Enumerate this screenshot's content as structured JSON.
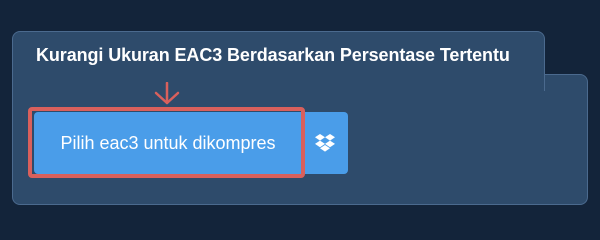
{
  "card": {
    "title": "Kurangi Ukuran EAC3 Berdasarkan Persentase Tertentu"
  },
  "upload": {
    "select_label": "Pilih eac3 untuk dikompres",
    "dropbox_icon": "dropbox-icon"
  },
  "annotation": {
    "arrow_icon": "down-arrow-icon",
    "color": "#d9605c"
  },
  "colors": {
    "background": "#13243a",
    "card": "#2e4b6b",
    "button": "#4a9de9"
  }
}
